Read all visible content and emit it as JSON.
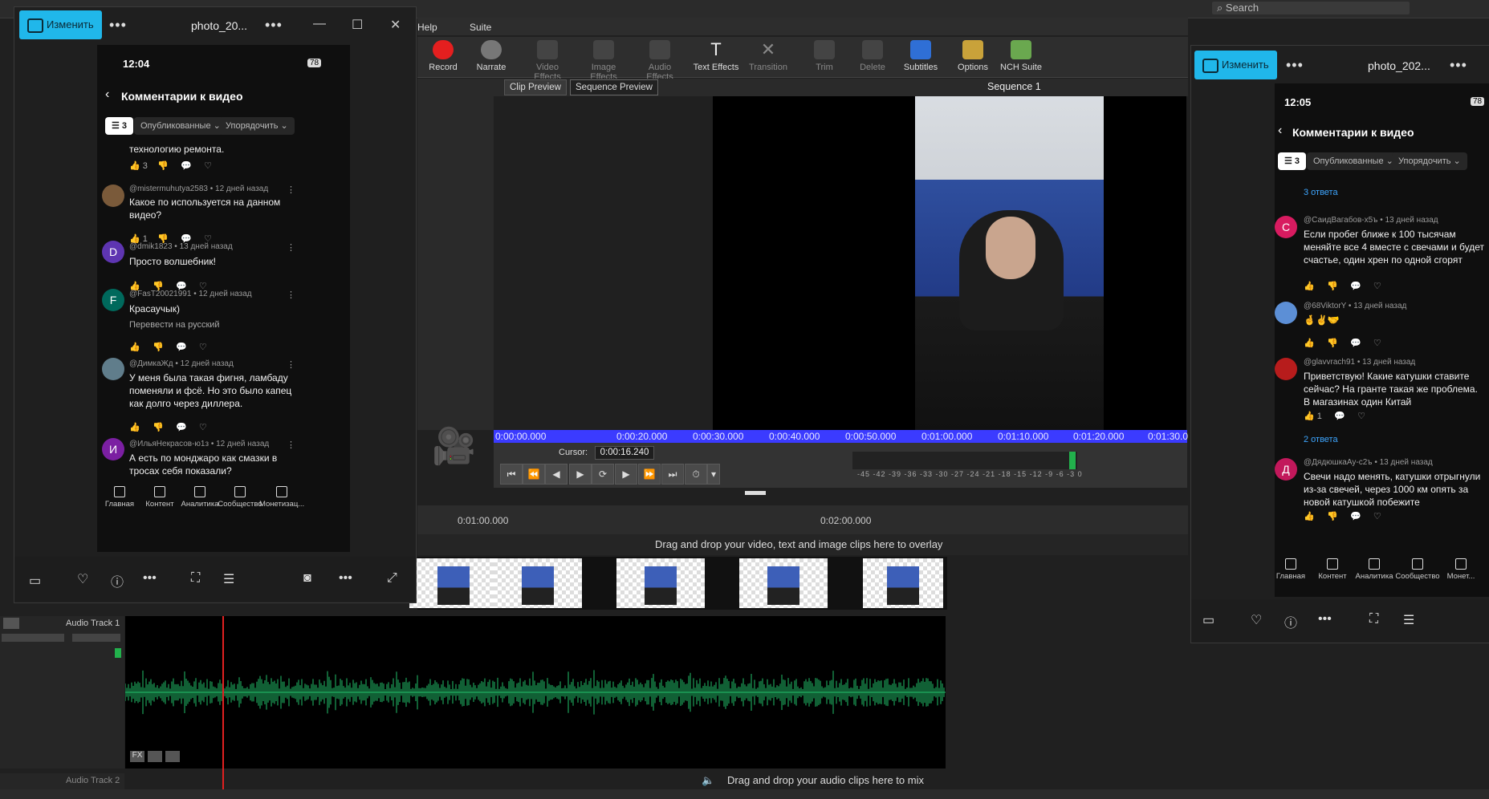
{
  "editor": {
    "menu": [
      "Help",
      "Suite"
    ],
    "search_placeholder": "Search",
    "toolbar": [
      {
        "label": "Record",
        "icon": "record-icon",
        "enabled": true
      },
      {
        "label": "Narrate",
        "icon": "microphone-icon",
        "enabled": true
      },
      {
        "label": "Video Effects",
        "icon": "video-effects-icon",
        "enabled": false
      },
      {
        "label": "Image Effects",
        "icon": "image-effects-icon",
        "enabled": false
      },
      {
        "label": "Audio Effects",
        "icon": "audio-effects-icon",
        "enabled": false
      },
      {
        "label": "Text Effects",
        "icon": "text-effects-icon",
        "enabled": true
      },
      {
        "label": "Transition",
        "icon": "transition-icon",
        "enabled": false
      },
      {
        "label": "Trim",
        "icon": "trim-icon",
        "enabled": false
      },
      {
        "label": "Delete",
        "icon": "delete-icon",
        "enabled": false
      },
      {
        "label": "Subtitles",
        "icon": "subtitles-icon",
        "enabled": true
      },
      {
        "label": "Options",
        "icon": "options-icon",
        "enabled": true
      },
      {
        "label": "NCH Suite",
        "icon": "nch-suite-icon",
        "enabled": true
      }
    ],
    "tabs": {
      "clip_preview": "Clip Preview",
      "sequence_preview": "Sequence Preview"
    },
    "sequence_title": "Sequence 1",
    "ruler_times": [
      "0:00:00.000",
      "0:00:20.000",
      "0:00:30.000",
      "0:00:40.000",
      "0:00:50.000",
      "0:01:00.000",
      "0:01:10.000",
      "0:01:20.000",
      "0:01:30.0"
    ],
    "cursor_label": "Cursor:",
    "cursor_value": "0:00:16.240",
    "meter_scale": "-45 -42 -39 -36 -33 -30 -27 -24 -21 -18 -15 -12 -9 -6 -3 0",
    "timeline_times": [
      "0:01:00.000",
      "0:02:00.000"
    ],
    "overlay_drop": "Drag and drop your video, text and image clips here to overlay",
    "audio_track1": "Audio Track 1",
    "audio_track2": "Audio Track 2",
    "audio_drop": "Drag and drop your audio clips here to mix",
    "fx_label": "FX"
  },
  "phone_left": {
    "edit_button": "Изменить",
    "file_name": "photo_20...",
    "time": "12:04",
    "battery": "78",
    "header": "Комментарии к видео",
    "filter_count": "3",
    "chip_published": "Опубликованные",
    "chip_sort": "Упорядочить",
    "top_text": "технологию ремонта.",
    "top_likes": "3",
    "comments": [
      {
        "user": "@mistermuhutya2583 • 12 дней назад",
        "text": "Какое по используется на данном видео?",
        "likes": "1",
        "avatar": "",
        "color": "#7a5a3a"
      },
      {
        "user": "@dmik1823 • 13 дней назад",
        "text": "Просто волшебник!",
        "likes": "",
        "avatar": "D",
        "color": "#5e35b1"
      },
      {
        "user": "@FasT20021991 • 12 дней назад",
        "text": "Красаучык)",
        "likes": "",
        "avatar": "F",
        "color": "#00695c",
        "translate": "Перевести на русский"
      },
      {
        "user": "@ДимкаЖд • 12 дней назад",
        "text": "У меня была такая фигня, ламбаду поменяли и  фсё. Но это было капец как долго через диллера.",
        "likes": "",
        "avatar": "",
        "color": "#607d8b"
      },
      {
        "user": "@ИльяНекрасов-ю1з • 12 дней назад",
        "text": "А есть по монджаро как смазки в тросах себя показали?",
        "likes": "",
        "avatar": "И",
        "color": "#7b1fa2"
      }
    ],
    "nav": [
      "Главная",
      "Контент",
      "Аналитика",
      "Сообщество",
      "Монетизац..."
    ]
  },
  "phone_right": {
    "edit_button": "Изменить",
    "file_name": "photo_202...",
    "time": "12:05",
    "battery": "78",
    "header": "Комментарии к видео",
    "filter_count": "3",
    "chip_published": "Опубликованные",
    "chip_sort": "Упорядочить",
    "replies1": "3 ответа",
    "replies2": "2 ответа",
    "comments": [
      {
        "user": "@СаидВагабов-х5ъ • 13 дней назад",
        "text": "Если пробег ближе к 100 тысячам меняйте все 4 вместе с свечами и будет счастье, один хрен по одной сгорят",
        "likes": "",
        "avatar": "С",
        "color": "#d81b60"
      },
      {
        "user": "@68ViktorY • 13 дней назад",
        "text": "🤞✌️🤝",
        "likes": "",
        "avatar": "",
        "color": "#5c8fd6"
      },
      {
        "user": "@glavvrach91 • 13 дней назад",
        "text": "Приветствую! Какие катушки ставите сейчас? На гранте такая же проблема. В магазинах один Китай",
        "likes": "1",
        "avatar": "",
        "color": "#b71c1c"
      },
      {
        "user": "@ДядюшкаАу-с2ъ • 13 дней назад",
        "text": "Свечи надо менять, катушки отрыгнули из-за свечей, через 1000 км опять за новой катушкой побежите",
        "likes": "",
        "avatar": "Д",
        "color": "#c2185b"
      }
    ],
    "nav": [
      "Главная",
      "Контент",
      "Аналитика",
      "Сообщество",
      "Монет..."
    ]
  }
}
